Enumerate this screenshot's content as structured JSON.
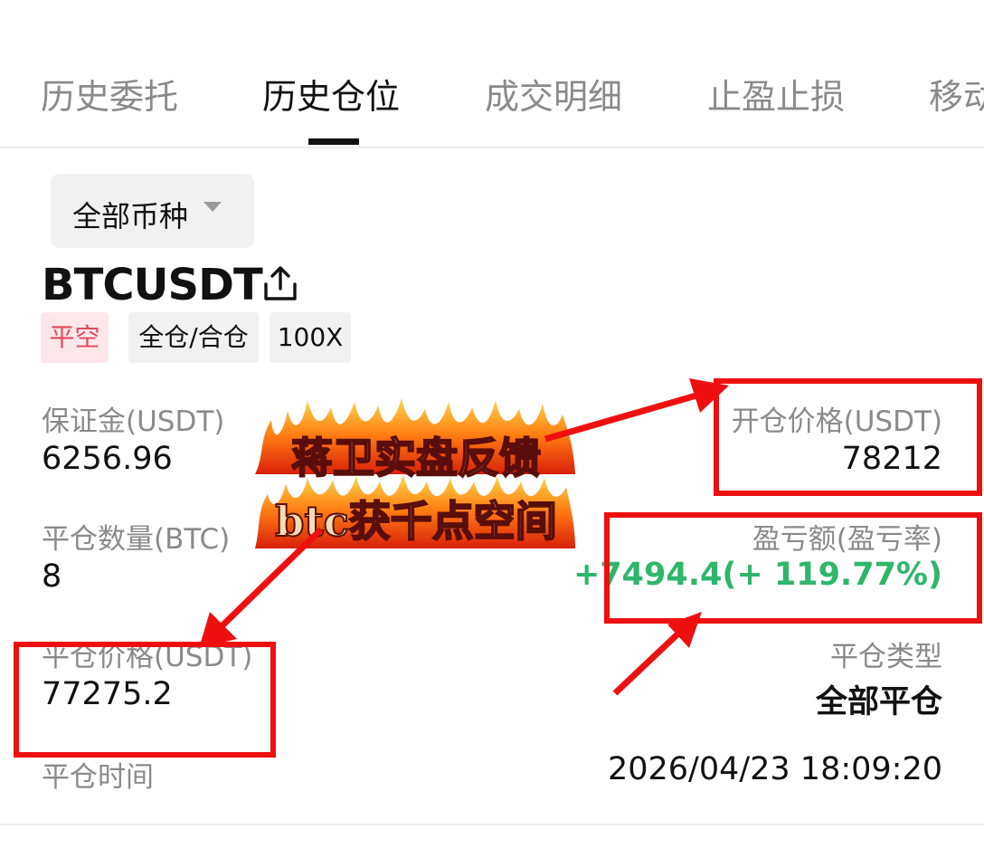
{
  "tabs": [
    {
      "label": "历史委托",
      "active": false
    },
    {
      "label": "历史仓位",
      "active": true
    },
    {
      "label": "成交明细",
      "active": false
    },
    {
      "label": "止盈止损",
      "active": false
    },
    {
      "label": "移动",
      "active": false
    }
  ],
  "filter": {
    "label": "全部币种"
  },
  "position": {
    "symbol": "BTCUSDT",
    "badges": [
      "平空",
      "全仓/合仓",
      "100X"
    ],
    "margin_label": "保证金(USDT)",
    "margin_value": "6256.96",
    "entry_price_label": "开仓价格(USDT)",
    "entry_price_value": "78212",
    "close_qty_label": "平仓数量(BTC)",
    "close_qty_value": "8",
    "pnl_label": "盈亏额(盈亏率)",
    "pnl_value": "+7494.4(+ 119.77%)",
    "close_price_label": "平仓价格(USDT)",
    "close_price_value": "77275.2",
    "close_type_label": "平仓类型",
    "close_type_value": "全部平仓",
    "close_time_label": "平仓时间",
    "close_time_value": "2026/04/23 18:09:20"
  },
  "overlay": {
    "line1": "蒋卫实盘反馈",
    "line2": "btc获千点空间"
  },
  "colors": {
    "accent_red": "#ee1010",
    "profit_green": "#2fb66a",
    "short_badge_text": "#e24a5c",
    "short_badge_bg": "#fde7ea"
  }
}
